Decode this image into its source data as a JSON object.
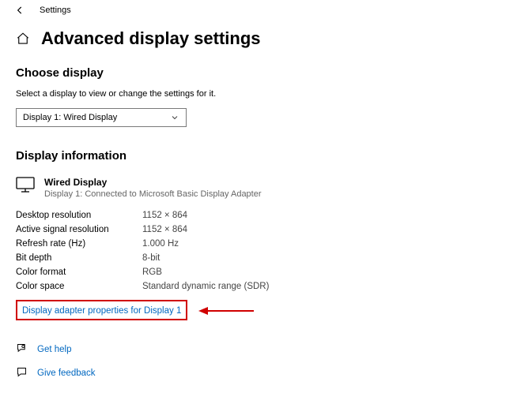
{
  "topbar": {
    "title": "Settings"
  },
  "page": {
    "title": "Advanced display settings",
    "choose_heading": "Choose display",
    "choose_sub": "Select a display to view or change the settings for it.",
    "dropdown_value": "Display 1: Wired Display",
    "info_heading": "Display information",
    "device_name": "Wired Display",
    "device_sub": "Display 1: Connected to Microsoft Basic Display Adapter",
    "specs": {
      "desktop_res_label": "Desktop resolution",
      "desktop_res_val": "1152 × 864",
      "active_res_label": "Active signal resolution",
      "active_res_val": "1152 × 864",
      "refresh_label": "Refresh rate (Hz)",
      "refresh_val": "1.000 Hz",
      "bitdepth_label": "Bit depth",
      "bitdepth_val": "8-bit",
      "colorfmt_label": "Color format",
      "colorfmt_val": "RGB",
      "colorspace_label": "Color space",
      "colorspace_val": "Standard dynamic range (SDR)"
    },
    "adapter_link": "Display adapter properties for Display 1",
    "help_link": "Get help",
    "feedback_link": "Give feedback"
  },
  "colors": {
    "link": "#0067c0",
    "highlight_box": "#d00000",
    "arrow": "#d00000"
  }
}
